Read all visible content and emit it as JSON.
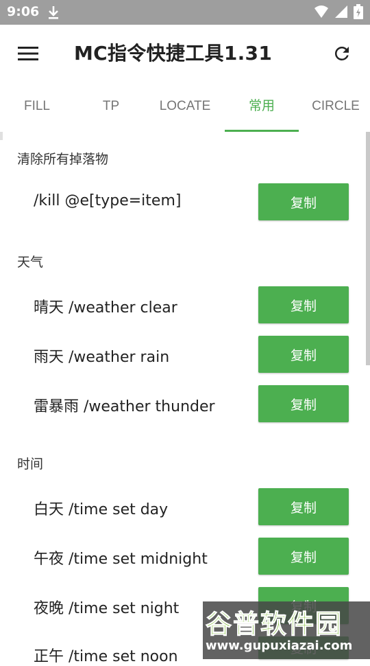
{
  "statusbar": {
    "time": "9:06"
  },
  "appbar": {
    "title": "MC指令快捷工具1.31"
  },
  "tabs": [
    {
      "label": "FILL"
    },
    {
      "label": "TP"
    },
    {
      "label": "LOCATE"
    },
    {
      "label": "常用",
      "active": true
    },
    {
      "label": "CIRCLE"
    }
  ],
  "sections": [
    {
      "title": "清除所有掉落物",
      "items": [
        {
          "label": "/kill @e[type=item]",
          "button": "复制"
        }
      ]
    },
    {
      "title": "天气",
      "items": [
        {
          "label": "晴天 /weather clear",
          "button": "复制"
        },
        {
          "label": "雨天 /weather rain",
          "button": "复制"
        },
        {
          "label": "雷暴雨 /weather thunder",
          "button": "复制"
        }
      ]
    },
    {
      "title": "时间",
      "items": [
        {
          "label": "白天 /time set day",
          "button": "复制"
        },
        {
          "label": "午夜 /time set midnight",
          "button": "复制"
        },
        {
          "label": "夜晚 /time set night",
          "button": "复制"
        },
        {
          "label": "正午 /time set noon",
          "button": "复制"
        }
      ]
    }
  ],
  "watermark": {
    "brand": "谷普软件园",
    "url": "www.gupuxiazai.com"
  },
  "colors": {
    "accent": "#4caf50",
    "statusbar": "#9e9e9e"
  },
  "icons": [
    "download-icon",
    "wifi-icon",
    "signal-icon",
    "battery-icon",
    "menu-icon",
    "refresh-icon"
  ]
}
